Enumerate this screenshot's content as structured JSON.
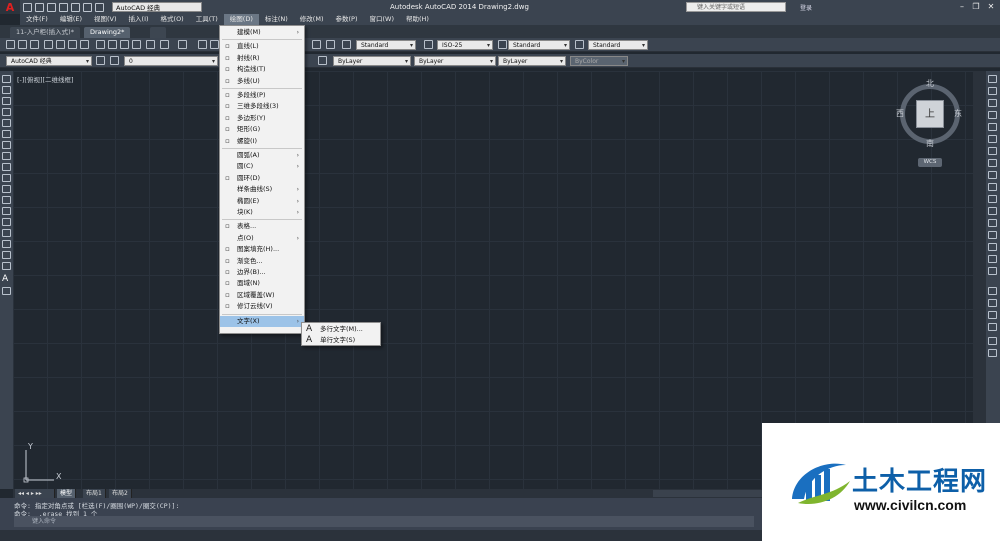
{
  "titlebar": {
    "app_icon": "A",
    "workspace": "AutoCAD 经典",
    "title": "Autodesk AutoCAD 2014    Drawing2.dwg",
    "search_placeholder": "键入关键字或短语",
    "login": "登录"
  },
  "menubar": [
    {
      "label": "文件(F)"
    },
    {
      "label": "编辑(E)"
    },
    {
      "label": "视图(V)"
    },
    {
      "label": "插入(I)"
    },
    {
      "label": "格式(O)"
    },
    {
      "label": "工具(T)"
    },
    {
      "label": "绘图(D)"
    },
    {
      "label": "标注(N)"
    },
    {
      "label": "修改(M)"
    },
    {
      "label": "参数(P)"
    },
    {
      "label": "窗口(W)"
    },
    {
      "label": "帮助(H)"
    }
  ],
  "tabs": [
    {
      "label": "11-入户柜(插入式)*"
    },
    {
      "label": "Drawing2*"
    }
  ],
  "toolbar1": {
    "text_style": "Standard",
    "dim_style": "ISO-25",
    "table_style": "Standard",
    "mleader_style": "Standard"
  },
  "toolbar2": {
    "workspace": "AutoCAD 经典",
    "layer": "0",
    "color": "ByLayer",
    "linetype": "ByLayer",
    "lineweight": "ByLayer",
    "plotstyle": "ByColor"
  },
  "viewport_label": "[-][俯视][二维线框]",
  "viewcube": {
    "top": "上",
    "north": "北",
    "south": "南",
    "east": "东",
    "west": "西",
    "wcs": "WCS"
  },
  "ucs": {
    "x": "X",
    "y": "Y"
  },
  "layout_tabs": [
    {
      "label": "模型"
    },
    {
      "label": "布局1"
    },
    {
      "label": "布局2"
    }
  ],
  "command": {
    "history": [
      "命令: 指定对角点或 [栏选(F)/圈围(WP)/圈交(CP)]:",
      "命令: _.erase 找到 1 个"
    ],
    "placeholder": "键入命令"
  },
  "draw_menu": {
    "items": [
      {
        "label": "建模(M)",
        "submenu": true
      },
      {
        "sep": true
      },
      {
        "label": "直线(L)",
        "icon": "line-icon"
      },
      {
        "label": "射线(R)",
        "icon": "ray-icon"
      },
      {
        "label": "构造线(T)",
        "icon": "xline-icon"
      },
      {
        "label": "多线(U)",
        "icon": "mline-icon"
      },
      {
        "sep": true
      },
      {
        "label": "多段线(P)",
        "icon": "polyline-icon"
      },
      {
        "label": "三维多段线(3)",
        "icon": "3dpoly-icon"
      },
      {
        "label": "多边形(Y)",
        "icon": "polygon-icon"
      },
      {
        "label": "矩形(G)",
        "icon": "rectangle-icon"
      },
      {
        "label": "螺旋(I)",
        "icon": "helix-icon"
      },
      {
        "sep": true
      },
      {
        "label": "圆弧(A)",
        "submenu": true
      },
      {
        "label": "圆(C)",
        "submenu": true
      },
      {
        "label": "圆环(D)",
        "icon": "donut-icon"
      },
      {
        "label": "样条曲线(S)",
        "submenu": true
      },
      {
        "label": "椭圆(E)",
        "submenu": true
      },
      {
        "label": "块(K)",
        "submenu": true
      },
      {
        "sep": true
      },
      {
        "label": "表格...",
        "icon": "table-icon"
      },
      {
        "label": "点(O)",
        "submenu": true
      },
      {
        "label": "图案填充(H)...",
        "icon": "hatch-icon"
      },
      {
        "label": "渐变色...",
        "icon": "gradient-icon"
      },
      {
        "label": "边界(B)...",
        "icon": "boundary-icon"
      },
      {
        "label": "面域(N)",
        "icon": "region-icon"
      },
      {
        "label": "区域覆盖(W)",
        "icon": "wipeout-icon"
      },
      {
        "label": "修订云线(V)",
        "icon": "revcloud-icon"
      },
      {
        "sep": true
      },
      {
        "label": "文字(X)",
        "submenu": true,
        "highlighted": true
      }
    ]
  },
  "text_submenu": [
    {
      "label": "多行文字(M)...",
      "icon": "A"
    },
    {
      "label": "单行文字(S)",
      "icon": "A"
    }
  ],
  "watermark": {
    "cn": "土木工程网",
    "url": "www.civilcn.com"
  }
}
